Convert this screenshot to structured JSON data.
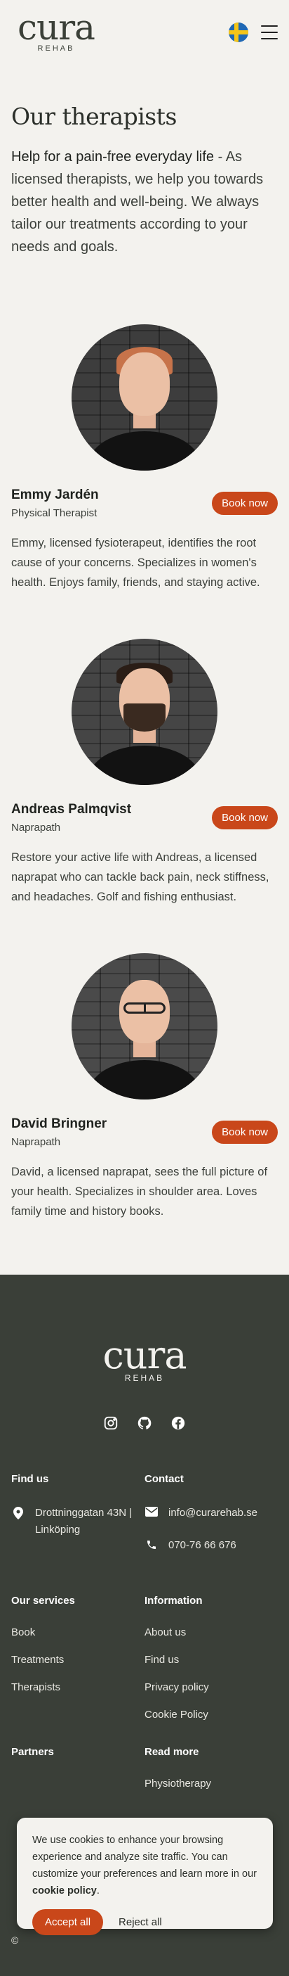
{
  "header": {
    "logo_word": "cura",
    "logo_sub": "REHAB",
    "language_flag": "sweden-flag-icon",
    "menu_icon": "hamburger-icon"
  },
  "page": {
    "title": "Our therapists",
    "intro_bold": "Help for a pain-free everyday life",
    "intro_rest": " - As licensed therapists, we help you towards better health and well-being. We always tailor our treatments according to your needs and goals."
  },
  "therapists": [
    {
      "name": "Emmy Jardén",
      "role": "Physical Therapist",
      "book_label": "Book now",
      "description": "Emmy, licensed fysioterapeut, identifies the root cause of your concerns. Specializes in women's health. Enjoys family, friends, and staying active."
    },
    {
      "name": "Andreas Palmqvist",
      "role": "Naprapath",
      "book_label": "Book now",
      "description": "Restore your active life with Andreas, a licensed naprapat who can tackle back pain, neck stiffness, and headaches. Golf and fishing enthusiast."
    },
    {
      "name": "David Bringner",
      "role": "Naprapath",
      "book_label": "Book now",
      "description": "David, a licensed naprapat, sees the full picture of your health. Specializes in shoulder area. Loves family time and history books."
    }
  ],
  "footer": {
    "logo_word": "cura",
    "logo_sub": "REHAB",
    "socials": [
      "instagram-icon",
      "github-icon",
      "facebook-icon"
    ],
    "find_us": {
      "heading": "Find us",
      "address": "Drottninggatan 43N | Linköping"
    },
    "contact": {
      "heading": "Contact",
      "email": "info@curarehab.se",
      "phone": "070-76 66 676"
    },
    "services": {
      "heading": "Our services",
      "links": [
        "Book",
        "Treatments",
        "Therapists"
      ]
    },
    "information": {
      "heading": "Information",
      "links": [
        "About us",
        "Find us",
        "Privacy policy",
        "Cookie Policy"
      ]
    },
    "partners": {
      "heading": "Partners"
    },
    "read_more": {
      "heading": "Read more",
      "links": [
        "Physiotherapy"
      ]
    },
    "copyright": "©"
  },
  "cookie": {
    "text": "We use cookies to enhance your browsing experience and analyze site traffic. You can customize your preferences and learn more in our ",
    "link": "cookie policy",
    "text_end": ".",
    "accept_label": "Accept all",
    "reject_label": "Reject all"
  },
  "colors": {
    "background": "#f3f2ee",
    "accent": "#c9471a",
    "footer": "#3a3f38"
  }
}
